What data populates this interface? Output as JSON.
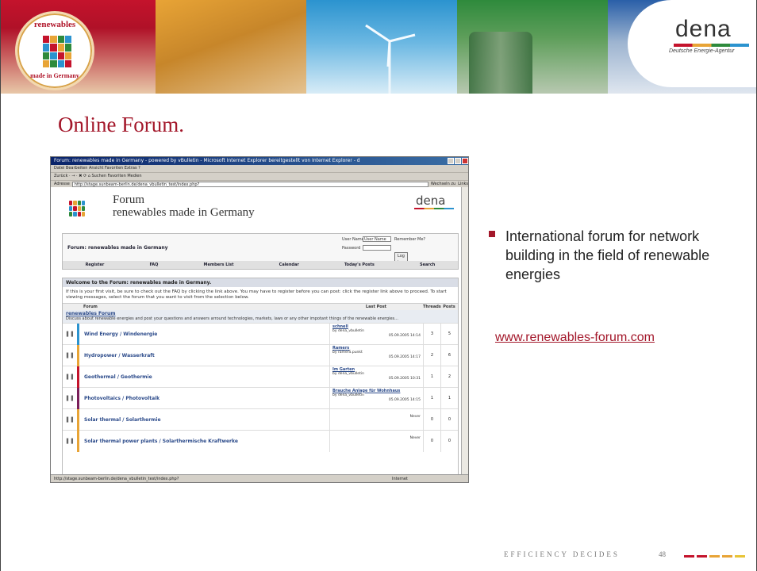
{
  "slide": {
    "title": "Online Forum.",
    "bullet": "International forum for network building in the field of renewable energies",
    "link": "www.renewables-forum.com",
    "footer": "EFFICIENCY DECIDES",
    "page_number": "48"
  },
  "banner": {
    "logo_top": "renewables",
    "logo_bottom": "made in Germany",
    "dena_name": "dena",
    "dena_tagline": "Deutsche Energie-Agentur"
  },
  "browser": {
    "title": "Forum: renewables made in Germany - powered by vBulletin - Microsoft Internet Explorer bereitgestellt von Internet Explorer - d",
    "menu": "Datei  Bearbeiten  Ansicht  Favoriten  Extras  ?",
    "toolbar": "Zurück  ·  →  ·  ✖  ⟳  ⌂   Suchen  Favoriten  Medien",
    "address_label": "Adresse",
    "address": "http://stage.sunbeam-berlin.de/dena_vbulletin_test/index.php?",
    "address_go": "Wechseln zu",
    "address_links": "Links",
    "status": "http://stage.sunbeam-berlin.de/dena_vbulletin_test/index.php?",
    "status_zone": "Internet"
  },
  "forum": {
    "header_title": "Forum",
    "header_sub": "renewables made in Germany",
    "dena": "dena",
    "nav_title": "Forum: renewables made in Germany",
    "login_user_label": "User Name",
    "login_user_value": "User Name",
    "login_pass_label": "Password",
    "remember": "Remember Me?",
    "login_button": "Log in",
    "nav": [
      "Register",
      "FAQ",
      "Members List",
      "Calendar",
      "Today's Posts",
      "Search"
    ],
    "welcome_title": "Welcome to the Forum: renewables made in Germany.",
    "welcome_text": "If this is your first visit, be sure to check out the FAQ by clicking the link above. You may have to register before you can post: click the register link above to proceed. To start viewing messages, select the forum that you want to visit from the selection below.",
    "col_forum": "Forum",
    "col_last": "Last Post",
    "col_threads": "Threads",
    "col_posts": "Posts",
    "category_title": "renewables Forum",
    "category_desc": "Discuss about renewable energies and post your questions and answers arround technologies, markets, laws or any other impotant things of the renewable energies...",
    "rows": [
      {
        "name": "Wind Energy / Windenergie",
        "last_title": "schnell",
        "last_by": "by dena_vbulletin",
        "last_date": "05.09.2005 14:14",
        "threads": "3",
        "posts": "5",
        "color": "#2b93cf"
      },
      {
        "name": "Hydropower / Wasserkraft",
        "last_title": "Ramers",
        "last_by": "by ramerS.punkt",
        "last_date": "05.09.2005 14:17",
        "threads": "2",
        "posts": "6",
        "color": "#e8a436"
      },
      {
        "name": "Geothermal / Geothermie",
        "last_title": "Im Garten",
        "last_by": "by dena_vbulletin",
        "last_date": "05.09.2005 10:31",
        "threads": "1",
        "posts": "2",
        "color": "#c4132c"
      },
      {
        "name": "Photovoltaics / Photovoltaik",
        "last_title": "Brauche Anlage für Wohnhaus",
        "last_by": "by dena_vbulletin",
        "last_date": "05.09.2005 14:15",
        "threads": "1",
        "posts": "1",
        "color": "#7a1e5a"
      },
      {
        "name": "Solar thermal / Solarthermie",
        "last_title": "",
        "last_by": "",
        "last_date": "Never",
        "threads": "0",
        "posts": "0",
        "color": "#e8a436"
      },
      {
        "name": "Solar thermal power plants / Solarthermische Kraftwerke",
        "last_title": "",
        "last_by": "",
        "last_date": "Never",
        "threads": "0",
        "posts": "0",
        "color": "#e8a436"
      }
    ]
  },
  "colors": {
    "accent": "#a3172a",
    "red": "#c4132c",
    "orange": "#e8a436",
    "blue": "#2b93cf",
    "green": "#2e8a3c"
  }
}
